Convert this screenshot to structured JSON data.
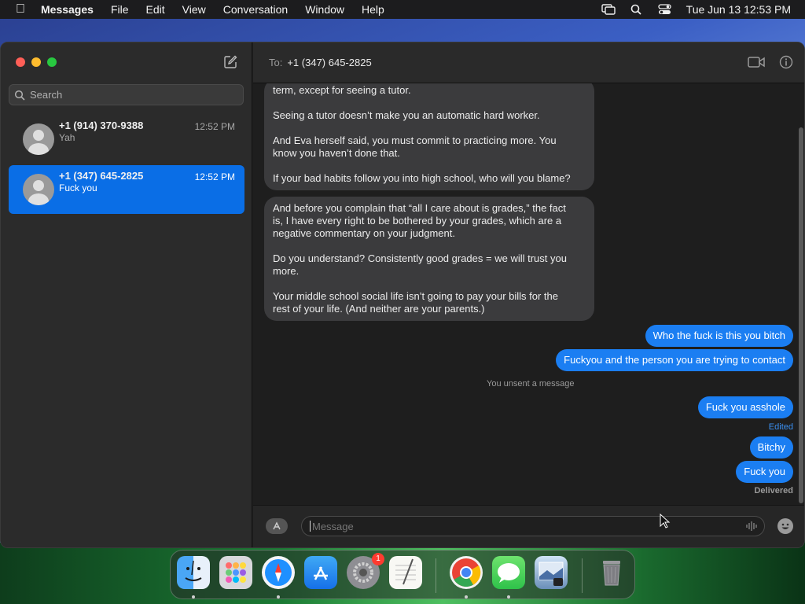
{
  "menubar": {
    "app_name": "Messages",
    "items": [
      "File",
      "Edit",
      "View",
      "Conversation",
      "Window",
      "Help"
    ],
    "datetime": "Tue Jun 13  12:53 PM"
  },
  "sidebar": {
    "search_placeholder": "Search",
    "conversations": [
      {
        "name": "+1 (914) 370-9388",
        "preview": "Yah",
        "time": "12:52 PM",
        "selected": false
      },
      {
        "name": "+1 (347) 645-2825",
        "preview": "Fuck you",
        "time": "12:52 PM",
        "selected": true
      }
    ]
  },
  "header": {
    "to_label": "To:",
    "to_value": "+1 (347) 645-2825"
  },
  "transcript": {
    "incoming": [
      {
        "text": "term, except for seeing a tutor.\n\nSeeing a tutor doesn’t make you an automatic hard worker.\n\nAnd Eva herself said, you must commit to practicing more.  You\nknow you haven’t done that.\n\nIf your bad habits follow you into high school, who will you blame?"
      },
      {
        "text": "And before you complain that “all I care about is grades,” the fact\nis, I have every right to be bothered by your grades, which are a\nnegative commentary on your judgment.\n\nDo you understand?  Consistently good grades = we will trust you\nmore.\n\nYour middle school social life isn’t going to pay your bills for the\nrest of your life.  (And neither are your parents.)"
      }
    ],
    "outgoing": [
      "Who the fuck is this you bitch",
      "Fuckyou and the person you are trying to contact",
      "Fuck you asshole",
      "Bitchy",
      "Fuck you"
    ],
    "unsent_note": "You unsent a message",
    "edited_label": "Edited",
    "delivered_label": "Delivered"
  },
  "composer": {
    "placeholder": "Message"
  },
  "dock": {
    "settings_badge": "1",
    "apps": [
      "finder-icon",
      "launchpad-icon",
      "safari-icon",
      "app-store-icon",
      "system-settings-icon",
      "textedit-icon",
      "chrome-icon",
      "messages-icon",
      "preview-icon",
      "trash-icon"
    ]
  },
  "colors": {
    "accent": "#0a6ee6",
    "outgoing_bubble": "#1b7ef2",
    "incoming_bubble": "#3b3b3d",
    "badge": "#ff3b30"
  }
}
